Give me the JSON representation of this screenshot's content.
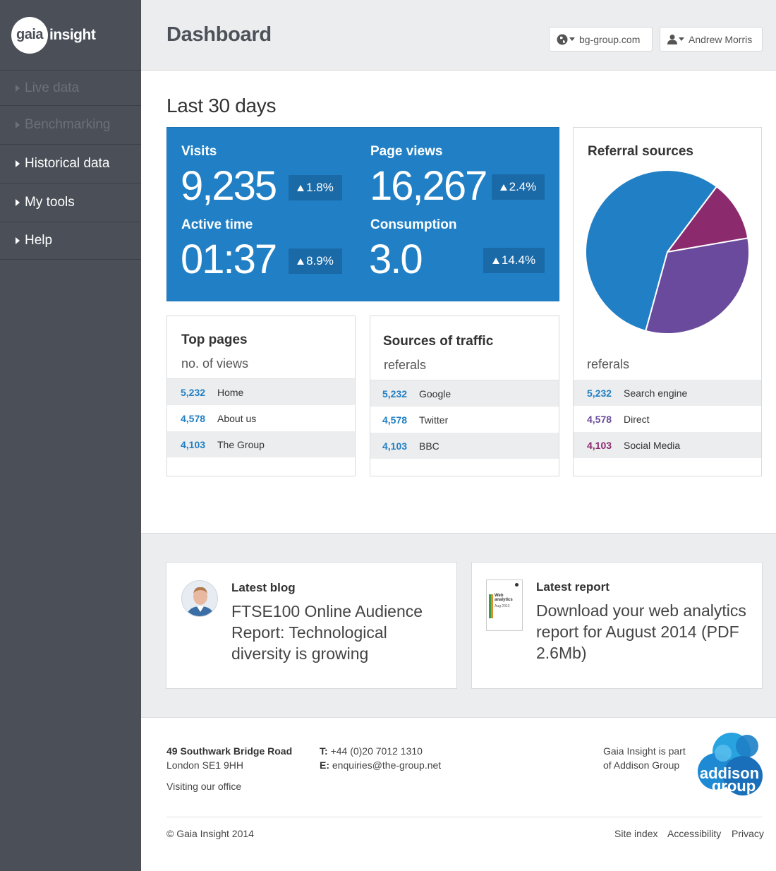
{
  "brand": {
    "logo_circle": "gaia",
    "logo_text": "insight"
  },
  "sidebar": {
    "items": [
      {
        "label": "Live data",
        "enabled": false
      },
      {
        "label": "Benchmarking",
        "enabled": false
      },
      {
        "label": "Historical data",
        "enabled": true
      },
      {
        "label": "My tools",
        "enabled": true
      },
      {
        "label": "Help",
        "enabled": true
      }
    ]
  },
  "header": {
    "title": "Dashboard",
    "site_selector": "bg-group.com",
    "user_menu": "Andrew Morris"
  },
  "main": {
    "range_title": "Last 30 days",
    "stats": [
      {
        "label": "Visits",
        "value": "9,235",
        "delta": "1.8%"
      },
      {
        "label": "Page views",
        "value": "16,267",
        "delta": "2.4%"
      },
      {
        "label": "Active time",
        "value": "01:37",
        "delta": "8.9%"
      },
      {
        "label": "Consumption",
        "value": "3.0",
        "delta": "14.4%"
      }
    ],
    "top_pages": {
      "title": "Top pages",
      "subtitle": "no. of views",
      "rows": [
        {
          "count": "5,232",
          "label": "Home"
        },
        {
          "count": "4,578",
          "label": "About us"
        },
        {
          "count": "4,103",
          "label": "The Group"
        }
      ]
    },
    "traffic": {
      "title": "Sources of traffic",
      "subtitle": "referals",
      "rows": [
        {
          "count": "5,232",
          "label": "Google"
        },
        {
          "count": "4,578",
          "label": "Twitter"
        },
        {
          "count": "4,103",
          "label": "BBC"
        }
      ]
    },
    "referral": {
      "title": "Referral sources",
      "subtitle": "referals",
      "rows": [
        {
          "count": "5,232",
          "label": "Search engine",
          "color": "#2180c5"
        },
        {
          "count": "4,578",
          "label": "Direct",
          "color": "#6a4a9c"
        },
        {
          "count": "4,103",
          "label": "Social Media",
          "color": "#8c2a6e"
        }
      ]
    }
  },
  "chart_data": {
    "type": "pie",
    "title": "Referral sources",
    "categories": [
      "Search engine",
      "Direct",
      "Social Media"
    ],
    "values": [
      0.56,
      0.32,
      0.12
    ],
    "colors": [
      "#2180c5",
      "#6a4a9c",
      "#8c2a6e"
    ]
  },
  "promos": {
    "blog": {
      "title": "Latest blog",
      "text": "FTSE100 Online Audience Report: Technological diversity is growing"
    },
    "report": {
      "title": "Latest report",
      "text": "Download your web analytics report for August 2014 (PDF 2.6Mb)",
      "thumb_title": "Web analytics",
      "thumb_date": "Aug 2013"
    }
  },
  "footer": {
    "address_line1": "49 Southwark Bridge Road",
    "address_line2": "London SE1 9HH",
    "visit_link": "Visiting our office",
    "phone_label": "T:",
    "phone": "+44 (0)20 7012 1310",
    "email_label": "E:",
    "email": "enquiries@the-group.net",
    "part_of_line1": "Gaia Insight is part",
    "part_of_line2": "of Addison Group",
    "addison_logo_line1": "addison",
    "addison_logo_line2": "group",
    "copyright": "© Gaia Insight 2014",
    "links": [
      "Site index",
      "Accessibility",
      "Privacy"
    ]
  }
}
